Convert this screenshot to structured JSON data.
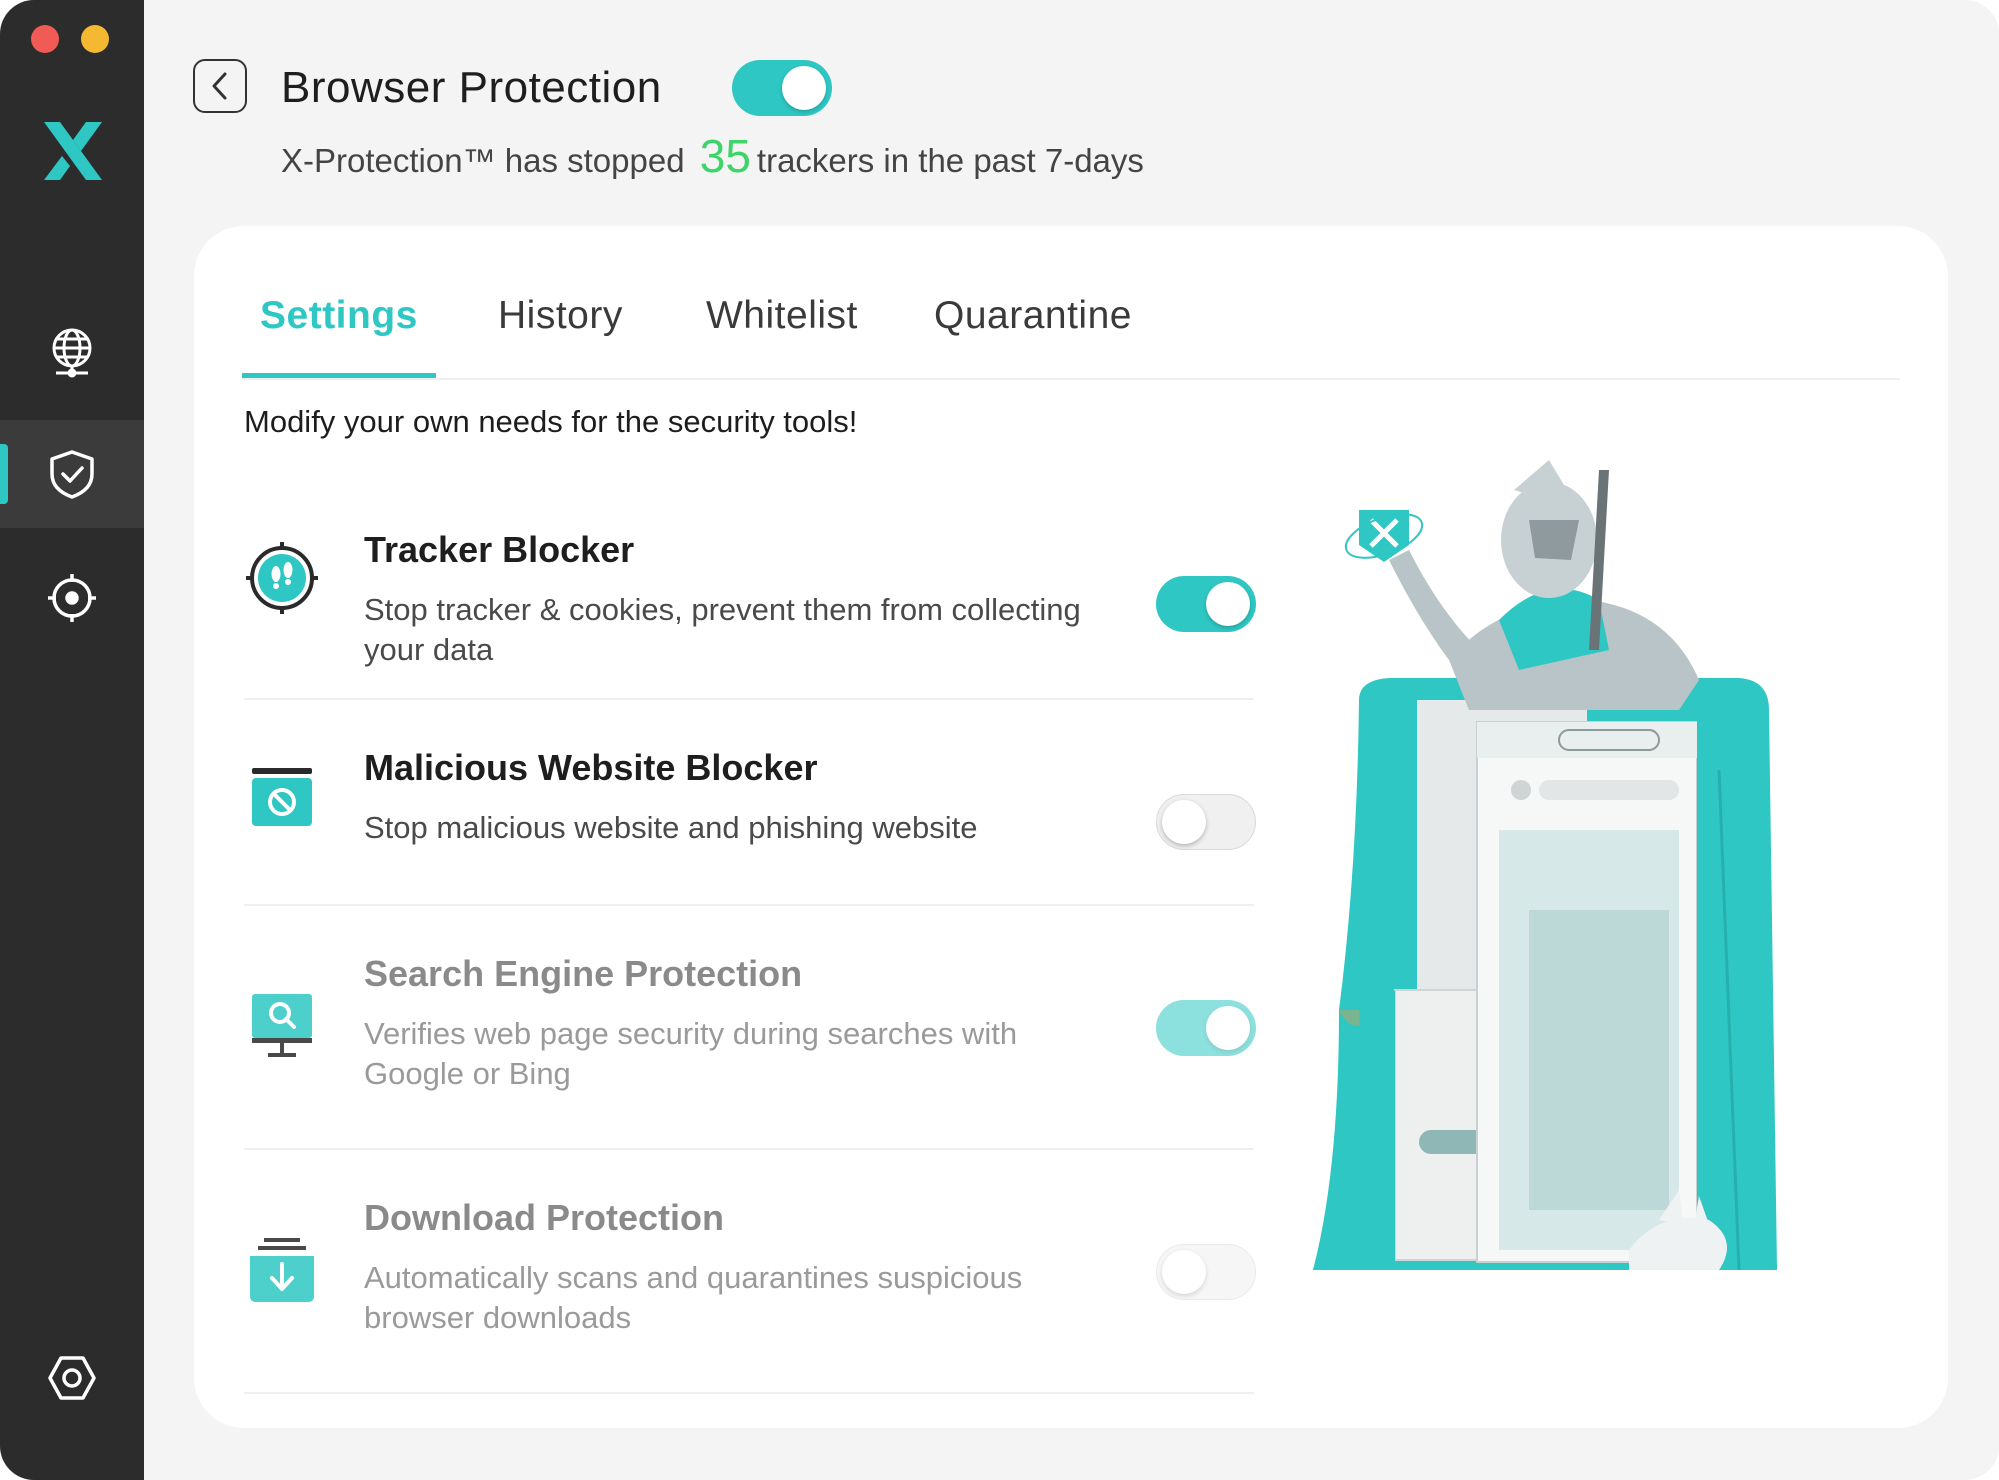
{
  "window": {
    "traffic_lights": [
      "close",
      "minimize"
    ]
  },
  "sidebar": {
    "logo": "X",
    "items": [
      {
        "icon": "globe-icon",
        "active": false
      },
      {
        "icon": "shield-check-icon",
        "active": true
      },
      {
        "icon": "crosshair-icon",
        "active": false
      }
    ],
    "settings_icon": "hexagon-settings-icon"
  },
  "header": {
    "title": "Browser Protection",
    "toggle_on": true,
    "subtitle_prefix": "X-Protection™  has stopped",
    "tracker_count": "35",
    "subtitle_suffix": "trackers in the past 7-days"
  },
  "tabs": [
    {
      "label": "Settings",
      "active": true
    },
    {
      "label": "History",
      "active": false
    },
    {
      "label": "Whitelist",
      "active": false
    },
    {
      "label": "Quarantine",
      "active": false
    }
  ],
  "intro": "Modify your own needs for the security tools!",
  "features": [
    {
      "title": "Tracker Blocker",
      "desc": "Stop tracker & cookies, prevent them from collecting your data",
      "enabled": true,
      "on": true,
      "icon": "footprint-target-icon"
    },
    {
      "title": "Malicious Website Blocker",
      "desc": "Stop malicious website and phishing website",
      "enabled": true,
      "on": false,
      "icon": "blocked-window-icon"
    },
    {
      "title": "Search Engine Protection",
      "desc": "Verifies web page security during searches with Google or Bing",
      "enabled": false,
      "on": true,
      "icon": "search-monitor-icon"
    },
    {
      "title": "Download Protection",
      "desc": "Automatically scans and quarantines suspicious browser downloads",
      "enabled": false,
      "on": false,
      "icon": "download-tray-icon"
    }
  ],
  "colors": {
    "accent": "#2fc7c3",
    "count": "#3ed46a",
    "sidebar": "#2c2c2c"
  }
}
